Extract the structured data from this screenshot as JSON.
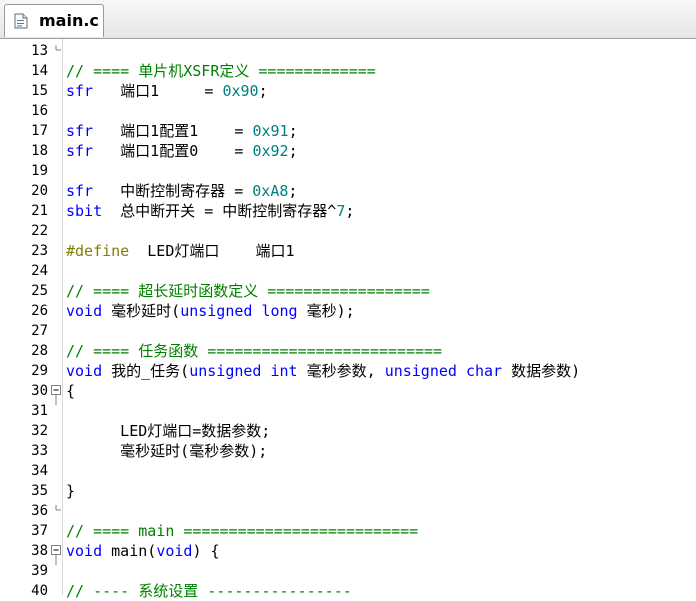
{
  "tab": {
    "label": "main.c",
    "icon": "c-file-icon"
  },
  "editor": {
    "lines": [
      {
        "num": "13",
        "fold": "end",
        "tokens": []
      },
      {
        "num": "14",
        "fold": "",
        "tokens": [
          {
            "t": "// ==== 单片机XSFR定义 =============",
            "c": "cm"
          }
        ]
      },
      {
        "num": "15",
        "fold": "",
        "tokens": [
          {
            "t": "sfr",
            "c": "kw"
          },
          {
            "t": "   端口1     = ",
            "c": "t"
          },
          {
            "t": "0x90",
            "c": "num"
          },
          {
            "t": ";",
            "c": "t"
          }
        ]
      },
      {
        "num": "16",
        "fold": "",
        "tokens": []
      },
      {
        "num": "17",
        "fold": "",
        "tokens": [
          {
            "t": "sfr",
            "c": "kw"
          },
          {
            "t": "   端口1配置1    = ",
            "c": "t"
          },
          {
            "t": "0x91",
            "c": "num"
          },
          {
            "t": ";",
            "c": "t"
          }
        ]
      },
      {
        "num": "18",
        "fold": "",
        "tokens": [
          {
            "t": "sfr",
            "c": "kw"
          },
          {
            "t": "   端口1配置0    = ",
            "c": "t"
          },
          {
            "t": "0x92",
            "c": "num"
          },
          {
            "t": ";",
            "c": "t"
          }
        ]
      },
      {
        "num": "19",
        "fold": "",
        "tokens": []
      },
      {
        "num": "20",
        "fold": "",
        "tokens": [
          {
            "t": "sfr",
            "c": "kw"
          },
          {
            "t": "   中断控制寄存器 = ",
            "c": "t"
          },
          {
            "t": "0xA8",
            "c": "num"
          },
          {
            "t": ";",
            "c": "t"
          }
        ]
      },
      {
        "num": "21",
        "fold": "",
        "tokens": [
          {
            "t": "sbit",
            "c": "kw"
          },
          {
            "t": "  总中断开关 = 中断控制寄存器^",
            "c": "t"
          },
          {
            "t": "7",
            "c": "num"
          },
          {
            "t": ";",
            "c": "t"
          }
        ]
      },
      {
        "num": "22",
        "fold": "",
        "tokens": []
      },
      {
        "num": "23",
        "fold": "",
        "tokens": [
          {
            "t": "#define",
            "c": "pp"
          },
          {
            "t": "  LED灯端口    端口1",
            "c": "t"
          }
        ]
      },
      {
        "num": "24",
        "fold": "",
        "tokens": []
      },
      {
        "num": "25",
        "fold": "",
        "tokens": [
          {
            "t": "// ==== 超长延时函数定义 ==================",
            "c": "cm"
          }
        ]
      },
      {
        "num": "26",
        "fold": "",
        "tokens": [
          {
            "t": "void",
            "c": "kw"
          },
          {
            "t": " 毫秒延时(",
            "c": "t"
          },
          {
            "t": "unsigned long",
            "c": "kw"
          },
          {
            "t": " 毫秒);",
            "c": "t"
          }
        ]
      },
      {
        "num": "27",
        "fold": "",
        "tokens": []
      },
      {
        "num": "28",
        "fold": "",
        "tokens": [
          {
            "t": "// ==== 任务函数 ==========================",
            "c": "cm"
          }
        ]
      },
      {
        "num": "29",
        "fold": "",
        "tokens": [
          {
            "t": "void",
            "c": "kw"
          },
          {
            "t": " 我的_任务(",
            "c": "t"
          },
          {
            "t": "unsigned int",
            "c": "kw"
          },
          {
            "t": " 毫秒参数, ",
            "c": "t"
          },
          {
            "t": "unsigned char",
            "c": "kw"
          },
          {
            "t": " 数据参数)",
            "c": "t"
          }
        ]
      },
      {
        "num": "30",
        "fold": "open",
        "tokens": [
          {
            "t": "{",
            "c": "t"
          }
        ]
      },
      {
        "num": "31",
        "fold": "",
        "tokens": []
      },
      {
        "num": "32",
        "fold": "",
        "tokens": [
          {
            "t": "      LED灯端口=数据参数;",
            "c": "t"
          }
        ]
      },
      {
        "num": "33",
        "fold": "",
        "tokens": [
          {
            "t": "      毫秒延时(毫秒参数);",
            "c": "t"
          }
        ]
      },
      {
        "num": "34",
        "fold": "",
        "tokens": []
      },
      {
        "num": "35",
        "fold": "",
        "tokens": [
          {
            "t": "}",
            "c": "t"
          }
        ]
      },
      {
        "num": "36",
        "fold": "end",
        "tokens": []
      },
      {
        "num": "37",
        "fold": "",
        "tokens": [
          {
            "t": "// ==== main ==========================",
            "c": "cm"
          }
        ]
      },
      {
        "num": "38",
        "fold": "open",
        "tokens": [
          {
            "t": "void",
            "c": "kw"
          },
          {
            "t": " main(",
            "c": "t"
          },
          {
            "t": "void",
            "c": "kw"
          },
          {
            "t": ") {",
            "c": "t"
          }
        ]
      },
      {
        "num": "39",
        "fold": "",
        "tokens": []
      },
      {
        "num": "40",
        "fold": "",
        "tokens": [
          {
            "t": "// ---- 系统设置 ----------------",
            "c": "cm"
          }
        ]
      }
    ]
  },
  "colors": {
    "keyword": "#0000ff",
    "comment": "#008000",
    "number": "#008080",
    "preprocessor": "#808000"
  }
}
